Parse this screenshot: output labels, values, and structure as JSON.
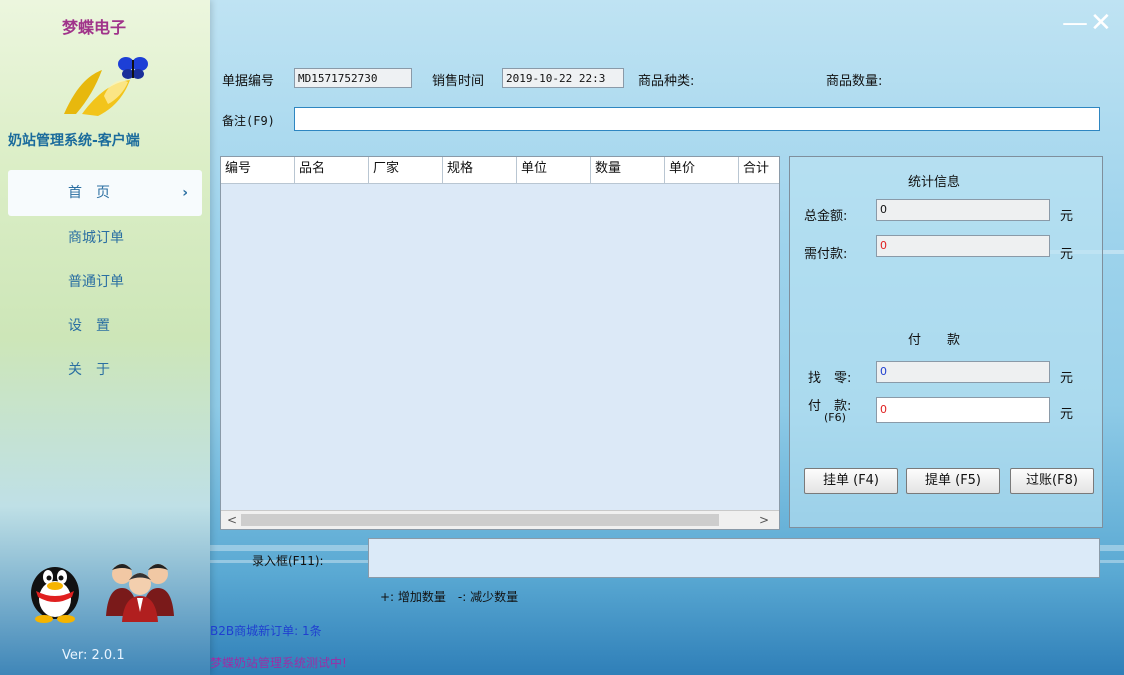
{
  "sidebar": {
    "brand": "梦蝶电子",
    "app_name": "奶站管理系统-客户端",
    "nav": [
      {
        "label": "首　页",
        "active": true
      },
      {
        "label": "商城订单",
        "active": false
      },
      {
        "label": "普通订单",
        "active": false
      },
      {
        "label": "设　置",
        "active": false
      },
      {
        "label": "关　于",
        "active": false
      }
    ],
    "version": "Ver: 2.0.1"
  },
  "window": {
    "minimize": "—",
    "close": "✕"
  },
  "header": {
    "bill_no_label": "单据编号",
    "bill_no_value": "MD1571752730",
    "sale_time_label": "销售时间",
    "sale_time_value": "2019-10-22 22:3",
    "goods_type_label": "商品种类:",
    "goods_qty_label": "商品数量:",
    "remark_label": "备注(F9)",
    "remark_value": ""
  },
  "grid": {
    "columns": [
      "编号",
      "品名",
      "厂家",
      "规格",
      "单位",
      "数量",
      "单价",
      "合计"
    ],
    "rows": [],
    "scroll_left": "<",
    "scroll_right": ">"
  },
  "stats": {
    "title": "统计信息",
    "total_label": "总金额:",
    "total_value": "0",
    "due_label": "需付款:",
    "due_value": "0",
    "unit": "元",
    "pay_title": "付　　款",
    "change_label": "找　零:",
    "change_value": "0",
    "pay_label": "付　款:",
    "pay_hint": "(F6)",
    "pay_value": "0",
    "buttons": {
      "hold": "挂单 (F4)",
      "retrieve": "提单 (F5)",
      "post": "过账(F8)"
    }
  },
  "entry": {
    "label": "录入框(F11):",
    "hint": "+: 增加数量　-: 减少数量"
  },
  "notices": {
    "b2b": "B2B商城新订单: 1条",
    "testing": "梦蝶奶站管理系统测试中!"
  },
  "colors": {
    "accent": "#2e86c1",
    "brand": "#a0338a",
    "value_red": "#e02020",
    "value_blue": "#2040d0"
  }
}
